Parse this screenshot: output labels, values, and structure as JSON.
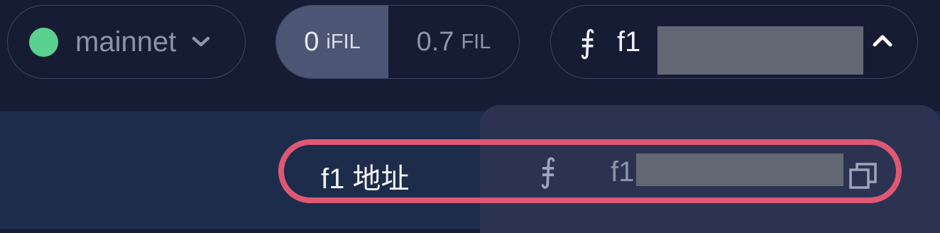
{
  "network": {
    "dot_color": "#5bd18f",
    "label": "mainnet",
    "icon": "chevron-down-icon"
  },
  "balance": {
    "ifil": {
      "amount": "0",
      "unit": "iFIL"
    },
    "fil": {
      "amount": "0.7",
      "unit": "FIL"
    }
  },
  "wallet": {
    "logo_glyph": "⨎",
    "address_prefix": "f1",
    "icon": "chevron-up-icon"
  },
  "dropdown": {
    "row": {
      "label": "f1 地址",
      "logo_glyph": "⨎",
      "address_prefix": "f1",
      "copy_icon": "copy-icon"
    }
  },
  "colors": {
    "highlight": "#de5873",
    "accent_green": "#5bd18f",
    "background": "#171c35"
  }
}
